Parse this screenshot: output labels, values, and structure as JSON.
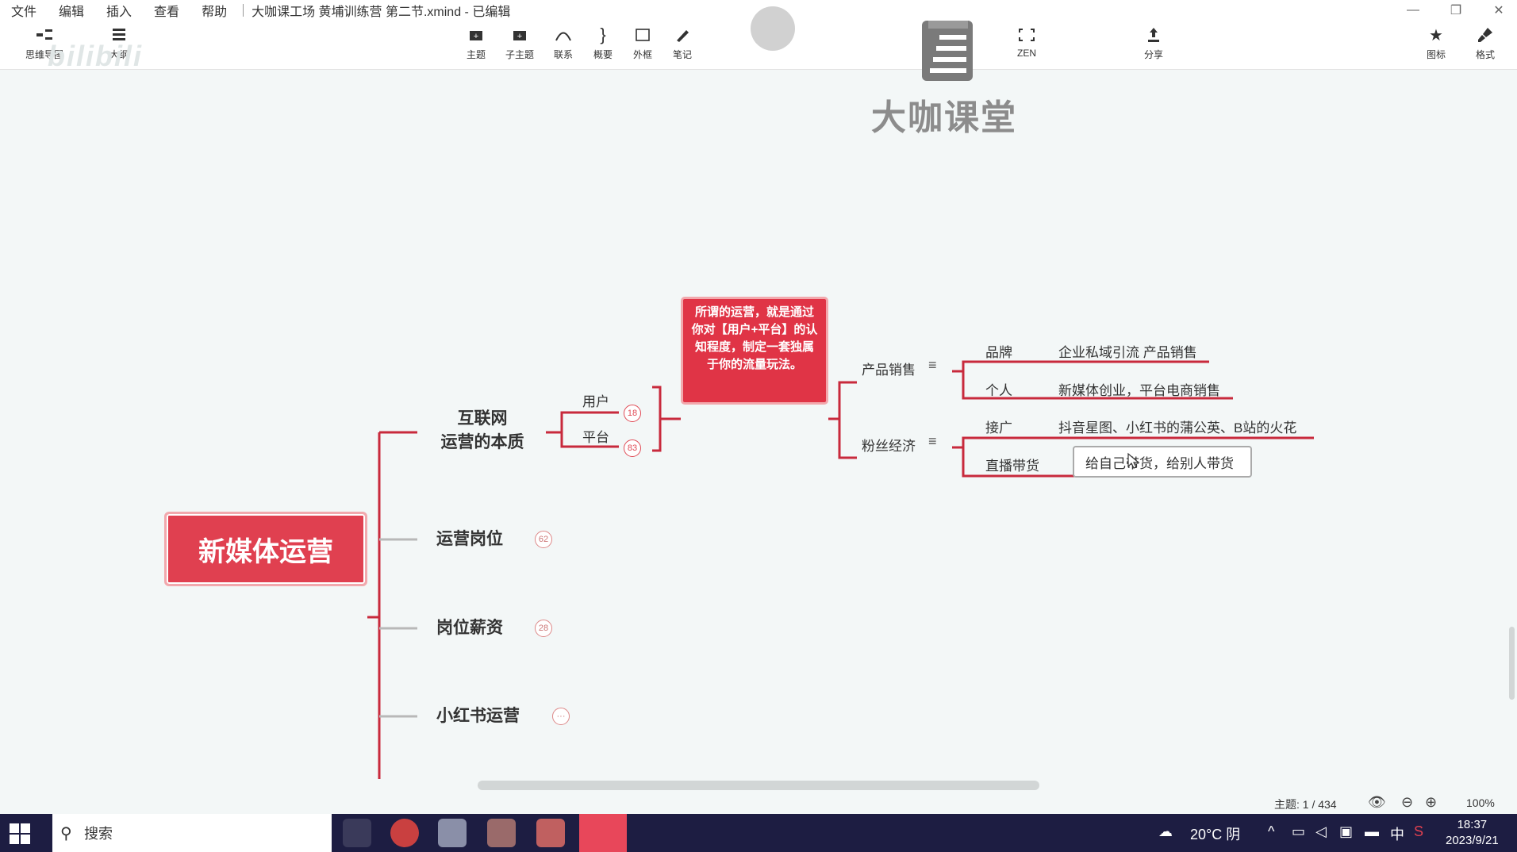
{
  "menubar": {
    "items": [
      "文件",
      "编辑",
      "插入",
      "查看",
      "帮助"
    ],
    "title": "大咖课工场 黄埔训练营 第二节.xmind - 已编辑"
  },
  "toolbar": {
    "left": [
      {
        "label": "思维导图",
        "icon": "mindmap-icon"
      },
      {
        "label": "大纲",
        "icon": "outline-icon"
      }
    ],
    "center": [
      {
        "label": "主题",
        "icon": "topic-icon"
      },
      {
        "label": "子主题",
        "icon": "subtopic-icon"
      },
      {
        "label": "联系",
        "icon": "relationship-icon"
      },
      {
        "label": "概要",
        "icon": "summary-icon"
      },
      {
        "label": "外框",
        "icon": "boundary-icon"
      },
      {
        "label": "笔记",
        "icon": "note-icon"
      }
    ],
    "zen": {
      "label": "ZEN",
      "icon": "zen-icon"
    },
    "share": {
      "label": "分享",
      "icon": "share-icon"
    },
    "right": [
      {
        "label": "图标",
        "icon": "star-icon"
      },
      {
        "label": "格式",
        "icon": "brush-icon"
      }
    ]
  },
  "watermark": {
    "brand": "大咖课堂",
    "bili": "bilibili"
  },
  "mindmap": {
    "central": "新媒体运营",
    "branches": [
      {
        "line1": "互联网",
        "line2": "运营的本质"
      },
      {
        "line1": "运营岗位",
        "badge": "62"
      },
      {
        "line1": "岗位薪资",
        "badge": "28"
      },
      {
        "line1": "小红书运营",
        "badge": "···"
      }
    ],
    "sub_user": {
      "label": "用户",
      "badge": "18"
    },
    "sub_platform": {
      "label": "平台",
      "badge": "83"
    },
    "callout": "所谓的运营，就是通过你对【用户+平台】的认知程度，制定一套独属于你的流量玩法。",
    "right_groups": [
      {
        "label": "产品销售",
        "children": [
          {
            "label": "品牌",
            "detail": "企业私域引流 产品销售"
          },
          {
            "label": "个人",
            "detail": "新媒体创业，平台电商销售"
          }
        ]
      },
      {
        "label": "粉丝经济",
        "children": [
          {
            "label": "接广",
            "detail": "抖音星图、小红书的蒲公英、B站的火花"
          },
          {
            "label": "直播带货",
            "detail": "给自己带货，给别人带货"
          }
        ]
      }
    ]
  },
  "status": {
    "topic_count": "主题: 1 / 434",
    "zoom": "100%"
  },
  "taskbar": {
    "search": "搜索",
    "weather": "20°C 阴",
    "ime": "中",
    "time": "18:37",
    "date": "2023/9/21"
  },
  "colors": {
    "accent": "#e04050",
    "line": "#c82a3c",
    "taskbar": "#1d1d42"
  }
}
